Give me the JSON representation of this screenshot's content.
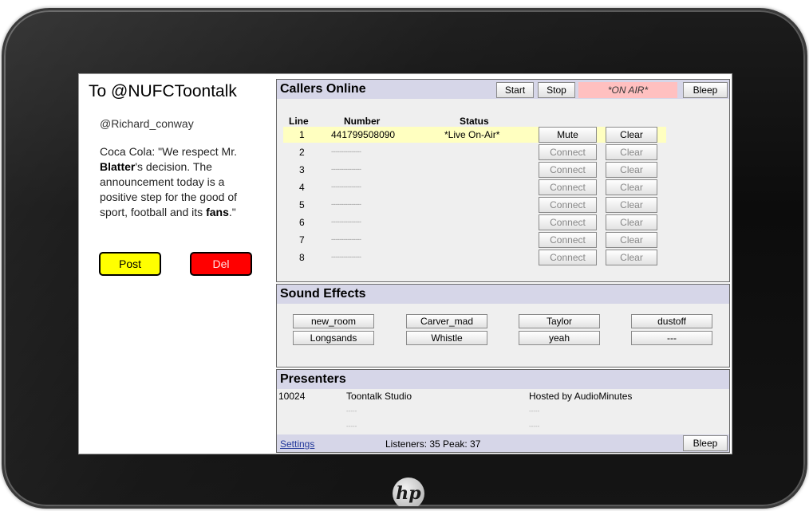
{
  "tweet": {
    "title": "To @NUFCToontalk",
    "handle": "@Richard_conway",
    "text_parts": [
      "Coca Cola: \"We respect Mr. ",
      "Blatter",
      "'s decision. The announcement today is a positive step for the good of sport, football and its ",
      "fans",
      ".\""
    ],
    "post_label": "Post",
    "del_label": "Del"
  },
  "callers": {
    "title": "Callers Online",
    "start_label": "Start",
    "stop_label": "Stop",
    "on_air_label": "*ON AIR*",
    "bleep_label": "Bleep",
    "columns": {
      "line": "Line",
      "number": "Number",
      "status": "Status"
    },
    "rows": [
      {
        "line": "1",
        "number": "441799508090",
        "status": "*Live On-Air*",
        "action": "Mute",
        "clear": "Clear"
      },
      {
        "line": "2",
        "number": "---------------",
        "status": "",
        "action": "Connect",
        "clear": "Clear"
      },
      {
        "line": "3",
        "number": "---------------",
        "status": "",
        "action": "Connect",
        "clear": "Clear"
      },
      {
        "line": "4",
        "number": "---------------",
        "status": "",
        "action": "Connect",
        "clear": "Clear"
      },
      {
        "line": "5",
        "number": "---------------",
        "status": "",
        "action": "Connect",
        "clear": "Clear"
      },
      {
        "line": "6",
        "number": "---------------",
        "status": "",
        "action": "Connect",
        "clear": "Clear"
      },
      {
        "line": "7",
        "number": "---------------",
        "status": "",
        "action": "Connect",
        "clear": "Clear"
      },
      {
        "line": "8",
        "number": "---------------",
        "status": "",
        "action": "Connect",
        "clear": "Clear"
      }
    ]
  },
  "sound_effects": {
    "title": "Sound Effects",
    "buttons": [
      "new_room",
      "Carver_mad",
      "Taylor",
      "dustoff",
      "Longsands",
      "Whistle",
      "yeah",
      "---"
    ]
  },
  "presenters": {
    "title": "Presenters",
    "id": "10024",
    "studio": "Toontalk Studio",
    "hosted": "Hosted by AudioMinutes",
    "blank": "-----",
    "settings_label": "Settings",
    "listeners_text": "Listeners: 35 Peak: 37",
    "bleep_label": "Bleep"
  },
  "device": {
    "logo_text": "hp"
  }
}
